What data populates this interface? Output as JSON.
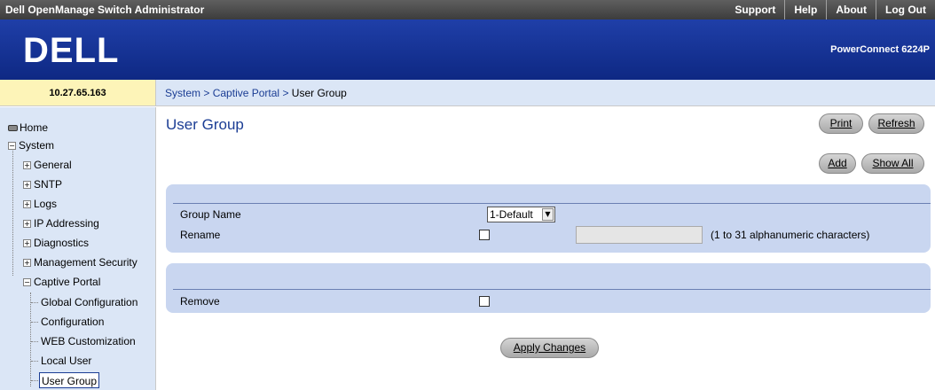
{
  "topbar": {
    "title": "Dell OpenManage Switch Administrator",
    "links": [
      "Support",
      "Help",
      "About",
      "Log Out"
    ]
  },
  "banner": {
    "logo": "DELL",
    "model": "PowerConnect 6224P"
  },
  "device_ip": "10.27.65.163",
  "breadcrumb": {
    "items": [
      "System",
      "Captive Portal",
      "User Group"
    ],
    "separator": ">"
  },
  "nav": {
    "home": "Home",
    "system": "System",
    "items": [
      "General",
      "SNTP",
      "Logs",
      "IP Addressing",
      "Diagnostics",
      "Management Security",
      "Captive Portal"
    ],
    "captive_children": [
      "Global Configuration",
      "Configuration",
      "WEB Customization",
      "Local User",
      "User Group"
    ],
    "selected": "User Group"
  },
  "page": {
    "title": "User Group",
    "buttons": {
      "print": "Print",
      "refresh": "Refresh",
      "add": "Add",
      "show_all": "Show All",
      "apply": "Apply Changes"
    }
  },
  "form": {
    "group_name_label": "Group Name",
    "group_name_value": "1-Default",
    "rename_label": "Rename",
    "rename_checked": false,
    "rename_value": "",
    "rename_hint": "(1 to 31 alphanumeric characters)",
    "remove_label": "Remove",
    "remove_checked": false
  },
  "colors": {
    "banner": "#0e2883",
    "accent": "#1b3d94",
    "nav_bg": "#dbe6f6",
    "panel_bg": "#c9d6f0",
    "ip_bg": "#fdf4b8"
  }
}
